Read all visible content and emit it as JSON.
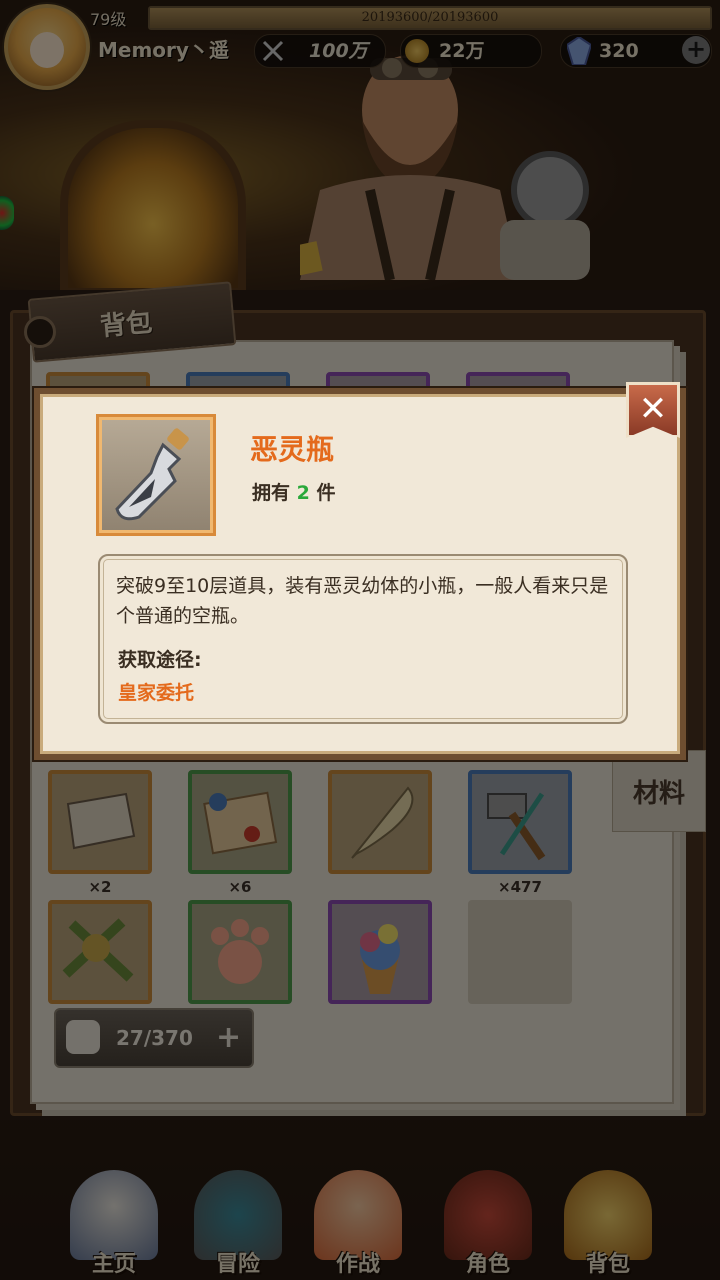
{
  "player": {
    "level": "79级",
    "xp": "20193600/20193600",
    "xp_fraction": 1.0,
    "name": "Memory丶遥",
    "power": "100万",
    "gold": "22万",
    "gems": "320"
  },
  "bag": {
    "tab_label": "背包",
    "category_tab": "材料",
    "row1": [
      {
        "border": "orange",
        "count": "×2",
        "icon": "map-scroll-icon"
      },
      {
        "border": "green",
        "count": "×6",
        "icon": "sealed-letter-icon"
      },
      {
        "border": "orange",
        "count": "",
        "icon": "quill-feather-icon"
      },
      {
        "border": "blue",
        "count": "×477",
        "icon": "hammer-chisel-icon"
      }
    ],
    "row2": [
      {
        "border": "orange",
        "icon": "tools-bundle-icon"
      },
      {
        "border": "green",
        "icon": "paw-print-icon"
      },
      {
        "border": "purple",
        "icon": "ice-cream-icon"
      },
      {
        "border": "empty",
        "icon": ""
      }
    ],
    "capacity": "27/370",
    "capacity_plus": "+"
  },
  "dialog": {
    "item_name": "恶灵瓶",
    "owned_prefix": "拥有",
    "owned_count": "2",
    "owned_suffix": "件",
    "description": "突破9至10层道具，装有恶灵幼体的小瓶，一般人看来只是个普通的空瓶。",
    "source_label": "获取途径:",
    "source_value": "皇家委托",
    "close_symbol": "✕",
    "item_icon": "spirit-bottle-icon"
  },
  "nav": [
    {
      "label": "主页",
      "icon": "home-icon"
    },
    {
      "label": "冒险",
      "icon": "adventure-icon"
    },
    {
      "label": "作战",
      "icon": "battle-icon"
    },
    {
      "label": "角色",
      "icon": "character-icon"
    },
    {
      "label": "背包",
      "icon": "bag-icon"
    }
  ],
  "hud_plus": "+"
}
